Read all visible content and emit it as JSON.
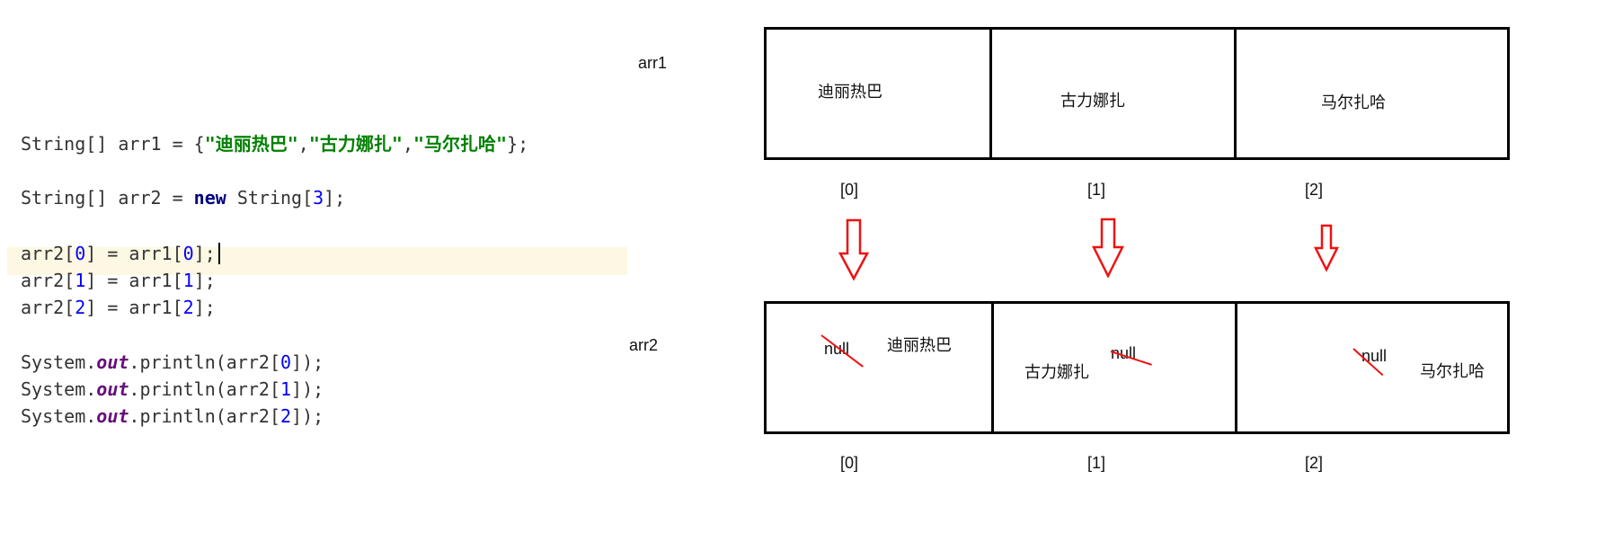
{
  "code": {
    "lines": [
      [
        [
          "String[] arr1 = {",
          ""
        ],
        [
          "\"迪丽热巴\"",
          "str"
        ],
        [
          ",",
          ""
        ],
        [
          "\"古力娜扎\"",
          "str"
        ],
        [
          ",",
          ""
        ],
        [
          "\"马尔扎哈\"",
          "str"
        ],
        [
          "};",
          ""
        ]
      ],
      [
        [
          "String[] arr2 = ",
          ""
        ],
        [
          "new",
          "kw"
        ],
        [
          " String[",
          ""
        ],
        [
          "3",
          "num"
        ],
        [
          "];",
          ""
        ]
      ],
      [
        [
          "arr2[",
          ""
        ],
        [
          "0",
          "num"
        ],
        [
          "] = arr1[",
          ""
        ],
        [
          "0",
          "num"
        ],
        [
          "];",
          ""
        ]
      ],
      [
        [
          "arr2[",
          ""
        ],
        [
          "1",
          "num"
        ],
        [
          "] = arr1[",
          ""
        ],
        [
          "1",
          "num"
        ],
        [
          "];",
          ""
        ]
      ],
      [
        [
          "arr2[",
          ""
        ],
        [
          "2",
          "num"
        ],
        [
          "] = arr1[",
          ""
        ],
        [
          "2",
          "num"
        ],
        [
          "];",
          ""
        ]
      ],
      [
        [
          "System.",
          ""
        ],
        [
          "out",
          "fld"
        ],
        [
          ".println(arr2[",
          ""
        ],
        [
          "0",
          "num"
        ],
        [
          "]);",
          ""
        ]
      ],
      [
        [
          "System.",
          ""
        ],
        [
          "out",
          "fld"
        ],
        [
          ".println(arr2[",
          ""
        ],
        [
          "1",
          "num"
        ],
        [
          "]);",
          ""
        ]
      ],
      [
        [
          "System.",
          ""
        ],
        [
          "out",
          "fld"
        ],
        [
          ".println(arr2[",
          ""
        ],
        [
          "2",
          "num"
        ],
        [
          "]);",
          ""
        ]
      ]
    ]
  },
  "arr1": {
    "label": "arr1",
    "cells": [
      "迪丽热巴",
      "古力娜扎",
      "马尔扎哈"
    ],
    "indices": [
      "[0]",
      "[1]",
      "[2]"
    ]
  },
  "arr2": {
    "label": "arr2",
    "cells": [
      {
        "old": "null",
        "new": "迪丽热巴"
      },
      {
        "old": "null",
        "new": "古力娜扎"
      },
      {
        "old": "null",
        "new": "马尔扎哈"
      }
    ],
    "indices": [
      "[0]",
      "[1]",
      "[2]"
    ]
  },
  "colors": {
    "arrow": "#ee1111",
    "strike": "#ee1111",
    "highlight": "#fcf8e3"
  }
}
